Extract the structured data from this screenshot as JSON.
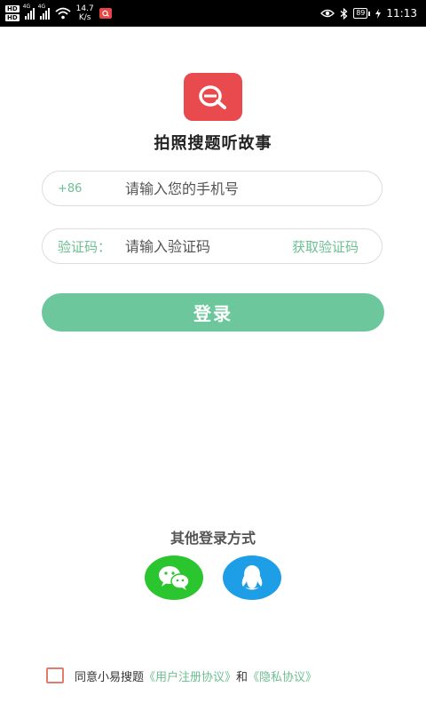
{
  "status_bar": {
    "hd1": "HD",
    "hd2": "HD",
    "net1": "4G",
    "net2": "4G",
    "speed_value": "14.7",
    "speed_unit": "K/s",
    "battery": "89",
    "time": "11:13"
  },
  "app": {
    "title": "拍照搜题听故事",
    "logo_color": "#e84a4e"
  },
  "phone_field": {
    "prefix": "+86",
    "placeholder": "请输入您的手机号"
  },
  "code_field": {
    "label": "验证码：",
    "placeholder": "请输入验证码",
    "get_code": "获取验证码"
  },
  "login_button": "登录",
  "other_login": {
    "label": "其他登录方式",
    "options": [
      "wechat-icon",
      "qq-icon"
    ]
  },
  "agreement": {
    "prefix": "同意小易搜题",
    "user_agreement": "《用户注册协议》",
    "and": "和",
    "privacy": "《隐私协议》"
  },
  "colors": {
    "accent": "#6cc092",
    "button": "#6cc89c",
    "wechat": "#2bc62f",
    "qq": "#1f9ee8",
    "checkbox": "#e47c6b"
  }
}
